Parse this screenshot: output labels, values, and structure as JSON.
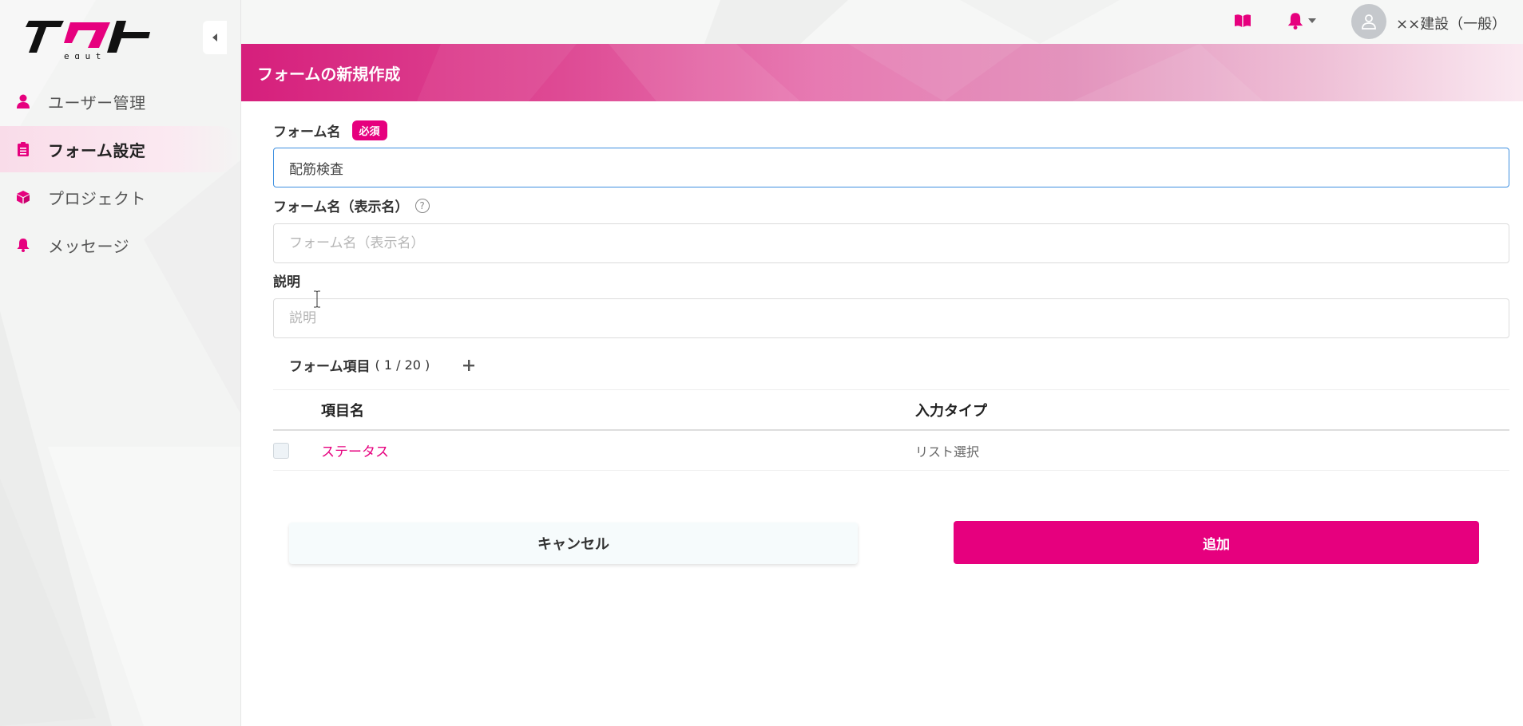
{
  "colors": {
    "accent": "#e6007e",
    "banner_start": "#d61f7c",
    "sidebar_bg": "#f3f4f3",
    "focus_border": "#3d8fe0"
  },
  "logo": {
    "main_text": "イクト",
    "sub_text": "e q u t"
  },
  "sidebar": {
    "items": [
      {
        "label": "ユーザー管理",
        "icon": "user-icon",
        "active": false
      },
      {
        "label": "フォーム設定",
        "icon": "clipboard-icon",
        "active": true
      },
      {
        "label": "プロジェクト",
        "icon": "cube-icon",
        "active": false
      },
      {
        "label": "メッセージ",
        "icon": "bell-icon",
        "active": false
      }
    ]
  },
  "topbar": {
    "user_name": "××建設（一般）",
    "icons": [
      "book-icon",
      "bell-icon",
      "caret-down-icon",
      "avatar-icon"
    ]
  },
  "banner": {
    "title": "フォームの新規作成"
  },
  "form": {
    "name": {
      "label": "フォーム名",
      "required_badge": "必須",
      "value": "配筋検査"
    },
    "display_name": {
      "label": "フォーム名（表示名）",
      "help": "?",
      "placeholder": "フォーム名（表示名）"
    },
    "description": {
      "label": "説明",
      "placeholder": "説明"
    },
    "items": {
      "title": "フォーム項目",
      "count": "( 1 / 20 )",
      "add_label": "+",
      "columns": [
        "項目名",
        "入力タイプ"
      ],
      "rows": [
        {
          "name": "ステータス",
          "type": "リスト選択"
        }
      ]
    }
  },
  "actions": {
    "cancel_label": "キャンセル",
    "add_label": "追加"
  }
}
